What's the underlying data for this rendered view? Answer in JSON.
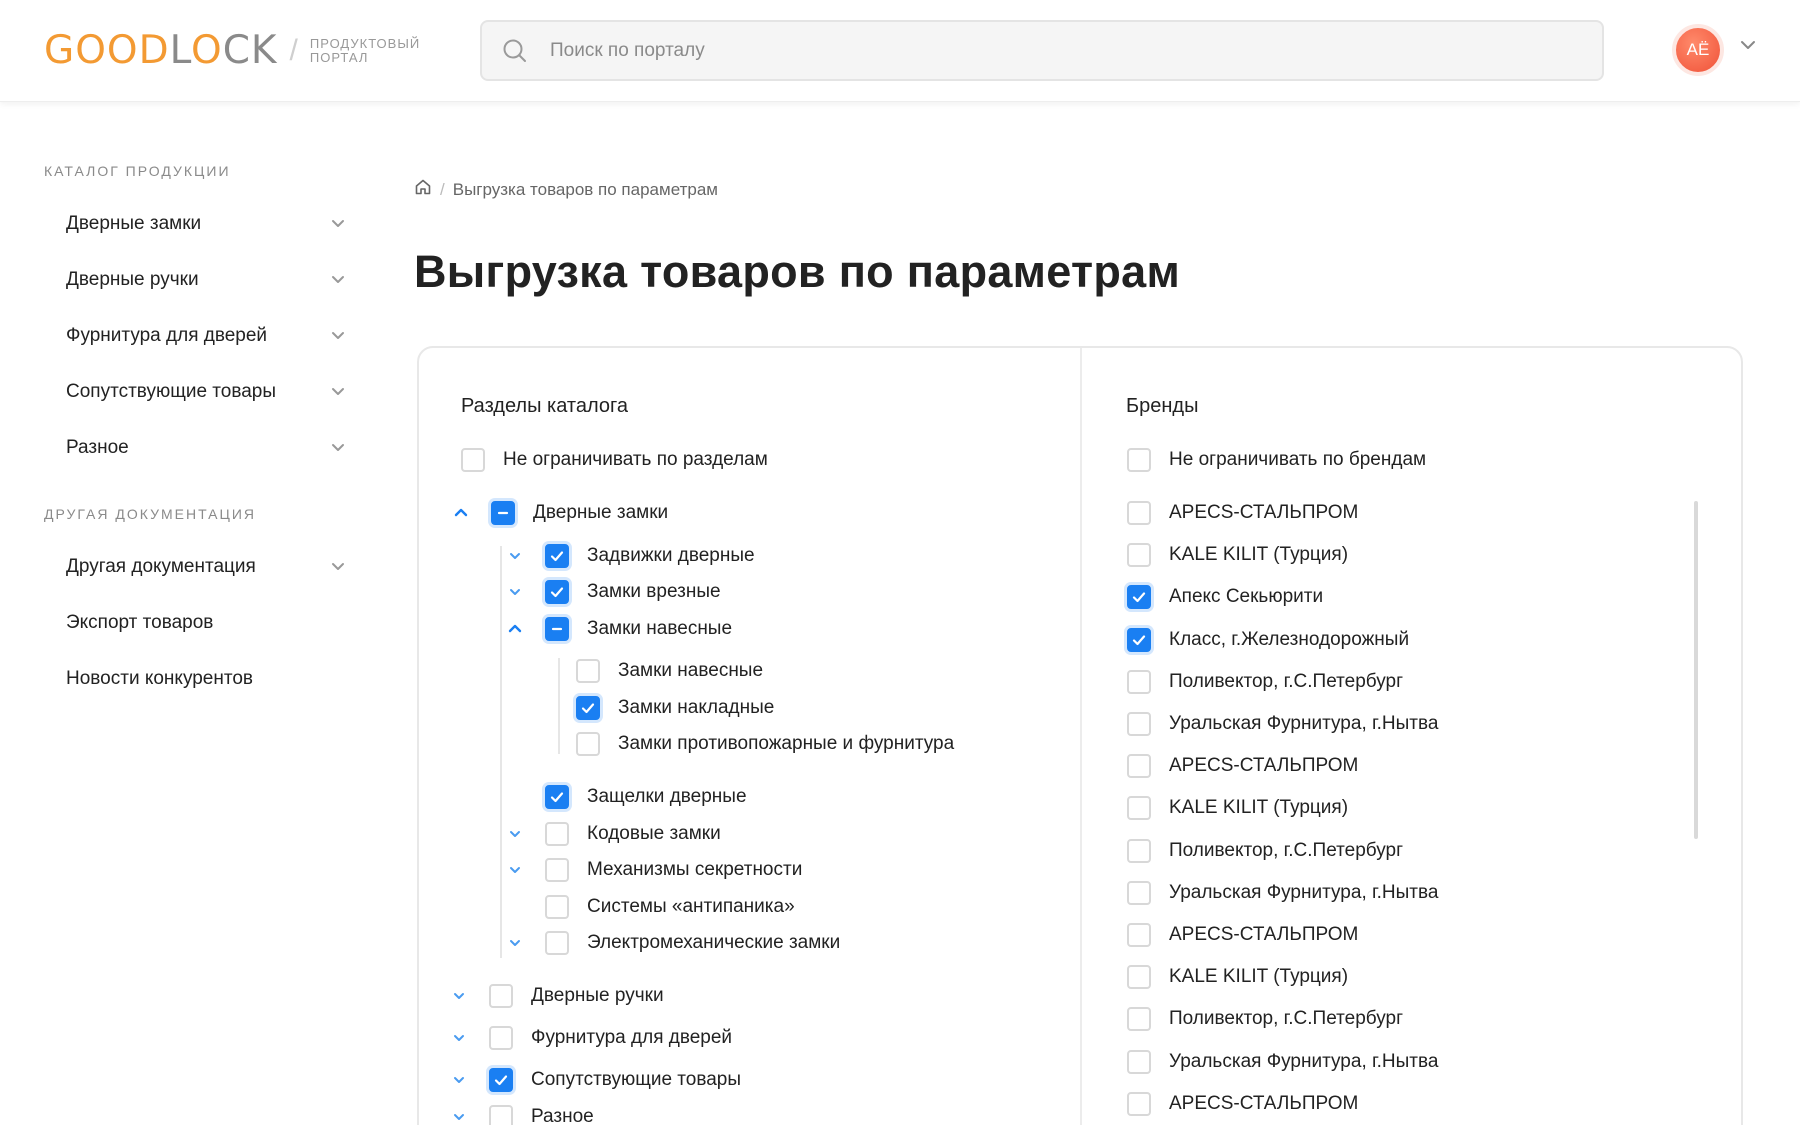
{
  "header": {
    "logo": {
      "good": "GOOD",
      "lock_l": "L",
      "lock_o": "O",
      "lock_ck": "CK",
      "sub_line1": "ПРОДУКТОВЫЙ",
      "sub_line2": "ПОРТАЛ"
    },
    "search": {
      "placeholder": "Поиск по порталу"
    },
    "avatar": {
      "initials": "АЁ"
    }
  },
  "sidebar": {
    "section1": "КАТАЛОГ ПРОДУКЦИИ",
    "catalog_items": [
      {
        "label": "Дверные замки"
      },
      {
        "label": "Дверные ручки"
      },
      {
        "label": "Фурнитура для дверей"
      },
      {
        "label": "Сопутствующие товары"
      },
      {
        "label": "Разное"
      }
    ],
    "section2": "ДРУГАЯ ДОКУМЕНТАЦИЯ",
    "doc_items": [
      {
        "label": "Другая документация"
      },
      {
        "label": "Экспорт товаров"
      },
      {
        "label": "Новости конкурентов"
      }
    ]
  },
  "breadcrumb": {
    "current": "Выгрузка товаров по параметрам"
  },
  "page_title": "Выгрузка товаров по параметрам",
  "catalog": {
    "title": "Разделы каталога",
    "no_limit": "Не ограничивать по разделам",
    "items": [
      {
        "label": "Дверные замки",
        "state": "partial"
      },
      {
        "label": "Задвижки дверные",
        "state": "checked"
      },
      {
        "label": "Замки врезные",
        "state": "checked"
      },
      {
        "label": "Замки навесные",
        "state": "partial"
      },
      {
        "label": "Замки навесные",
        "state": "none"
      },
      {
        "label": "Замки накладные",
        "state": "checked"
      },
      {
        "label": "Замки противопожарные и фурнитура",
        "state": "none"
      },
      {
        "label": "Защелки дверные",
        "state": "checked"
      },
      {
        "label": "Кодовые замки",
        "state": "none"
      },
      {
        "label": "Механизмы секретности",
        "state": "none"
      },
      {
        "label": "Системы «антипаника»",
        "state": "none"
      },
      {
        "label": "Электромеханические замки",
        "state": "none"
      },
      {
        "label": "Дверные ручки",
        "state": "none"
      },
      {
        "label": "Фурнитура для дверей",
        "state": "none"
      },
      {
        "label": "Сопутствующие товары",
        "state": "checked"
      },
      {
        "label": "Разное",
        "state": "none"
      }
    ]
  },
  "brands": {
    "title": "Бренды",
    "no_limit": "Не ограничивать по брендам",
    "items": [
      {
        "label": "APECS-СТАЛЬПРОМ",
        "checked": false
      },
      {
        "label": "KALE KILIT (Турция)",
        "checked": false
      },
      {
        "label": "Апекс Секьюрити",
        "checked": true
      },
      {
        "label": "Класс, г.Железнодорожный",
        "checked": true
      },
      {
        "label": "Поливектор, г.С.Петербург",
        "checked": false
      },
      {
        "label": "Уральская Фурнитура, г.Нытва",
        "checked": false
      },
      {
        "label": "APECS-СТАЛЬПРОМ",
        "checked": false
      },
      {
        "label": "KALE KILIT (Турция)",
        "checked": false
      },
      {
        "label": "Поливектор, г.С.Петербург",
        "checked": false
      },
      {
        "label": "Уральская Фурнитура, г.Нытва",
        "checked": false
      },
      {
        "label": "APECS-СТАЛЬПРОМ",
        "checked": false
      },
      {
        "label": "KALE KILIT (Турция)",
        "checked": false
      },
      {
        "label": "Поливектор, г.С.Петербург",
        "checked": false
      },
      {
        "label": "Уральская Фурнитура, г.Нытва",
        "checked": false
      },
      {
        "label": "APECS-СТАЛЬПРОМ",
        "checked": false
      }
    ]
  },
  "colors": {
    "accent": "#1a7ff2",
    "brand_orange": "#f39a33",
    "avatar": "#f05238"
  }
}
